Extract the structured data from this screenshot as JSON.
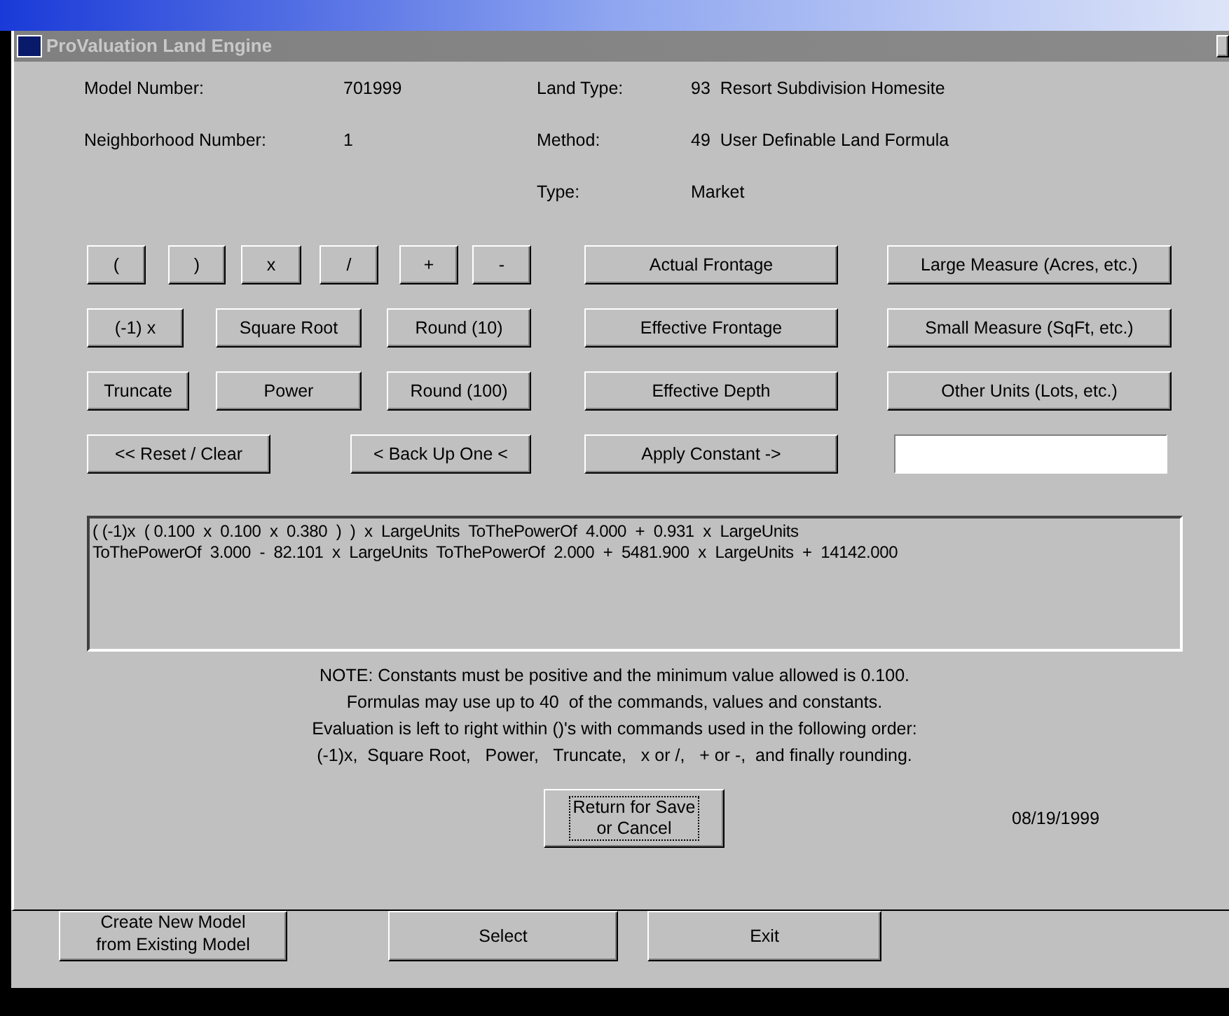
{
  "window": {
    "title": "ProValuation Land Engine"
  },
  "left_fields": [
    {
      "label": "Model Number:",
      "value": "701999"
    },
    {
      "label": "Neighborhood Number:",
      "value": "1"
    }
  ],
  "right_fields": [
    {
      "label": "Land Type:",
      "value": "93  Resort Subdivision Homesite"
    },
    {
      "label": "Method:",
      "value": "49  User Definable Land Formula"
    },
    {
      "label": "Type:",
      "value": "Market"
    }
  ],
  "button_rows": [
    [
      "(",
      ")",
      "x",
      "/",
      "+",
      "-",
      "Actual Frontage",
      "Large Measure (Acres, etc.)"
    ],
    [
      "(-1) x",
      "Square Root",
      "Round (10)",
      "Effective Frontage",
      "Small Measure (SqFt, etc.)"
    ],
    [
      "Truncate",
      "Power",
      "Round (100)",
      "Effective Depth",
      "Other Units (Lots, etc.)"
    ],
    [
      "<< Reset / Clear",
      "< Back Up One <",
      "Apply Constant ->"
    ]
  ],
  "formula_lines": [
    "( (-1)x  ( 0.100  x  0.100  x  0.380  )  )  x  LargeUnits  ToThePowerOf  4.000  +  0.931  x  LargeUnits",
    "ToThePowerOf  3.000  -  82.101  x  LargeUnits  ToThePowerOf  2.000  +  5481.900  x  LargeUnits  +  14142.000"
  ],
  "notes": [
    "NOTE: Constants must be positive and the minimum value allowed is 0.100.",
    "Formulas may use up to 40  of the commands, values and constants.",
    "Evaluation is left to right within ()'s with commands used in the following order:",
    "(-1)x,  Square Root,   Power,   Truncate,   x or /,   + or -,  and finally rounding."
  ],
  "return_button": {
    "lines": [
      "Return for Save",
      "or Cancel"
    ],
    "focused": true
  },
  "date": "08/19/1999",
  "background_window": {
    "buttons": [
      {
        "lines": [
          "Create New Model",
          "from Existing Model"
        ]
      },
      {
        "lines": [
          "Select"
        ]
      },
      {
        "lines": [
          "Exit"
        ]
      }
    ]
  }
}
